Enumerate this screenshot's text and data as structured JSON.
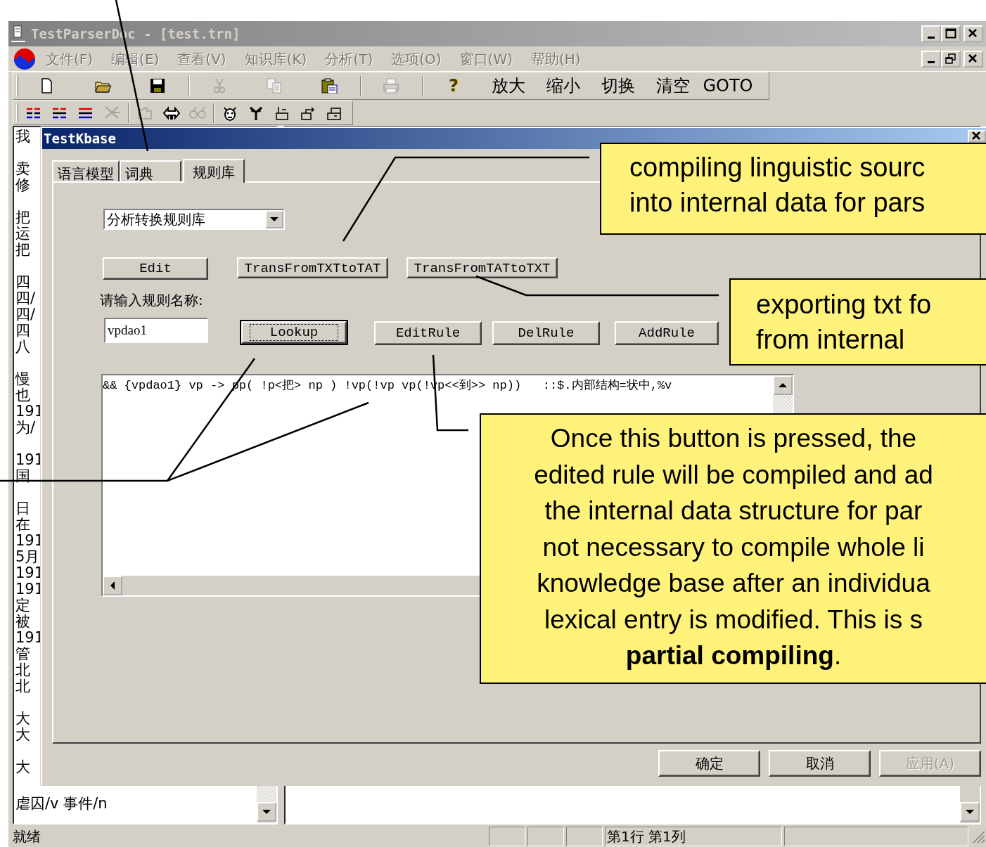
{
  "window": {
    "title": "TestParserDoc - [test.trn]"
  },
  "menu": [
    {
      "label": "文件(F)",
      "disabled": true
    },
    {
      "label": "编辑(E)",
      "disabled": true
    },
    {
      "label": "查看(V)",
      "disabled": true
    },
    {
      "label": "知识库(K)",
      "disabled": true
    },
    {
      "label": "分析(T)",
      "disabled": true
    },
    {
      "label": "选项(O)",
      "disabled": true
    },
    {
      "label": "窗口(W)",
      "disabled": true
    },
    {
      "label": "帮助(H)",
      "disabled": true
    }
  ],
  "toolbar": [
    {
      "kind": "icon",
      "disabled": false
    },
    {
      "kind": "icon",
      "disabled": false
    },
    {
      "kind": "icon",
      "disabled": false
    },
    {
      "kind": "separator"
    },
    {
      "kind": "icon",
      "disabled": true
    },
    {
      "kind": "icon",
      "disabled": true
    },
    {
      "kind": "icon",
      "disabled": false
    },
    {
      "kind": "separator"
    },
    {
      "kind": "icon",
      "disabled": true
    },
    {
      "kind": "separator"
    },
    {
      "kind": "glyph",
      "text": "?"
    },
    {
      "kind": "text",
      "label": "放大"
    },
    {
      "kind": "text",
      "label": "缩小"
    },
    {
      "kind": "text",
      "label": "切换"
    },
    {
      "kind": "text",
      "label": "清空"
    },
    {
      "kind": "text",
      "label": "GOTO"
    }
  ],
  "toolbar_2": [
    {
      "kind": "icon",
      "disabled": false
    },
    {
      "kind": "icon",
      "disabled": false
    },
    {
      "kind": "icon",
      "disabled": false
    },
    {
      "kind": "icon",
      "disabled": true
    },
    {
      "kind": "separator"
    },
    {
      "kind": "icon",
      "disabled": true
    },
    {
      "kind": "icon",
      "disabled": false
    },
    {
      "kind": "icon",
      "disabled": true
    },
    {
      "kind": "separator"
    },
    {
      "kind": "icon",
      "disabled": false
    },
    {
      "kind": "icon",
      "disabled": false
    },
    {
      "kind": "icon",
      "disabled": false
    },
    {
      "kind": "icon",
      "disabled": false
    },
    {
      "kind": "icon",
      "disabled": false
    }
  ],
  "document_pane": {
    "groups": [
      [
        "我"
      ],
      [
        "卖",
        "修"
      ],
      [
        "把",
        "运",
        "把"
      ],
      [
        "四",
        "四/",
        "四/",
        "四",
        "八"
      ],
      [
        "慢",
        "也",
        "191",
        "为/"
      ],
      [
        "191",
        "国"
      ],
      [
        "日",
        "在",
        "191",
        "5月",
        "191",
        "191",
        "定",
        "被",
        "191",
        "管",
        "北",
        "北"
      ],
      [
        "大",
        "大"
      ],
      [
        "大"
      ]
    ],
    "last_line": "虐囚/v 事件/n"
  },
  "dialog": {
    "title": "TestKbase",
    "tabs": [
      {
        "label": "语言模型",
        "selected": false
      },
      {
        "label": "词典",
        "selected": false
      },
      {
        "label": "规则库",
        "selected": true
      }
    ],
    "rule_base_select": "分析转换规则库",
    "buttons_row_1": [
      "Edit",
      "TransFromTXTtoTAT",
      "TransFromTATtoTXT"
    ],
    "name_label": "请输入规则名称:",
    "name_input": "vpdao1",
    "buttons_row_2": [
      {
        "label": "Lookup",
        "default": true
      },
      {
        "label": "EditRule",
        "default": false
      },
      {
        "label": "DelRule",
        "default": false
      },
      {
        "label": "AddRule",
        "default": false
      }
    ],
    "rule_text": "&& {vpdao1} vp -> pp( !p<把> np ) !vp(!vp vp(!vp<<到>> np))   ::$.内部结构=状中,%v",
    "footer_buttons": [
      {
        "label": "确定",
        "disabled": false
      },
      {
        "label": "取消",
        "disabled": false
      },
      {
        "label": "应用(A)",
        "disabled": true
      }
    ]
  },
  "status_bar": {
    "message": "就绪",
    "position": "第1行 第1列"
  },
  "callouts": [
    {
      "lines": [
        "compiling linguistic sourc",
        "into internal data for pars"
      ]
    },
    {
      "lines": [
        "exporting txt fo",
        "from internal"
      ]
    },
    {
      "lines": [
        "Once this button is pressed, the",
        "edited rule will be compiled and ad",
        "the internal data structure for par",
        "not necessary to compile whole li",
        "knowledge base after an individua",
        "lexical entry is modified. This is s",
        "**partial compiling**."
      ]
    }
  ]
}
